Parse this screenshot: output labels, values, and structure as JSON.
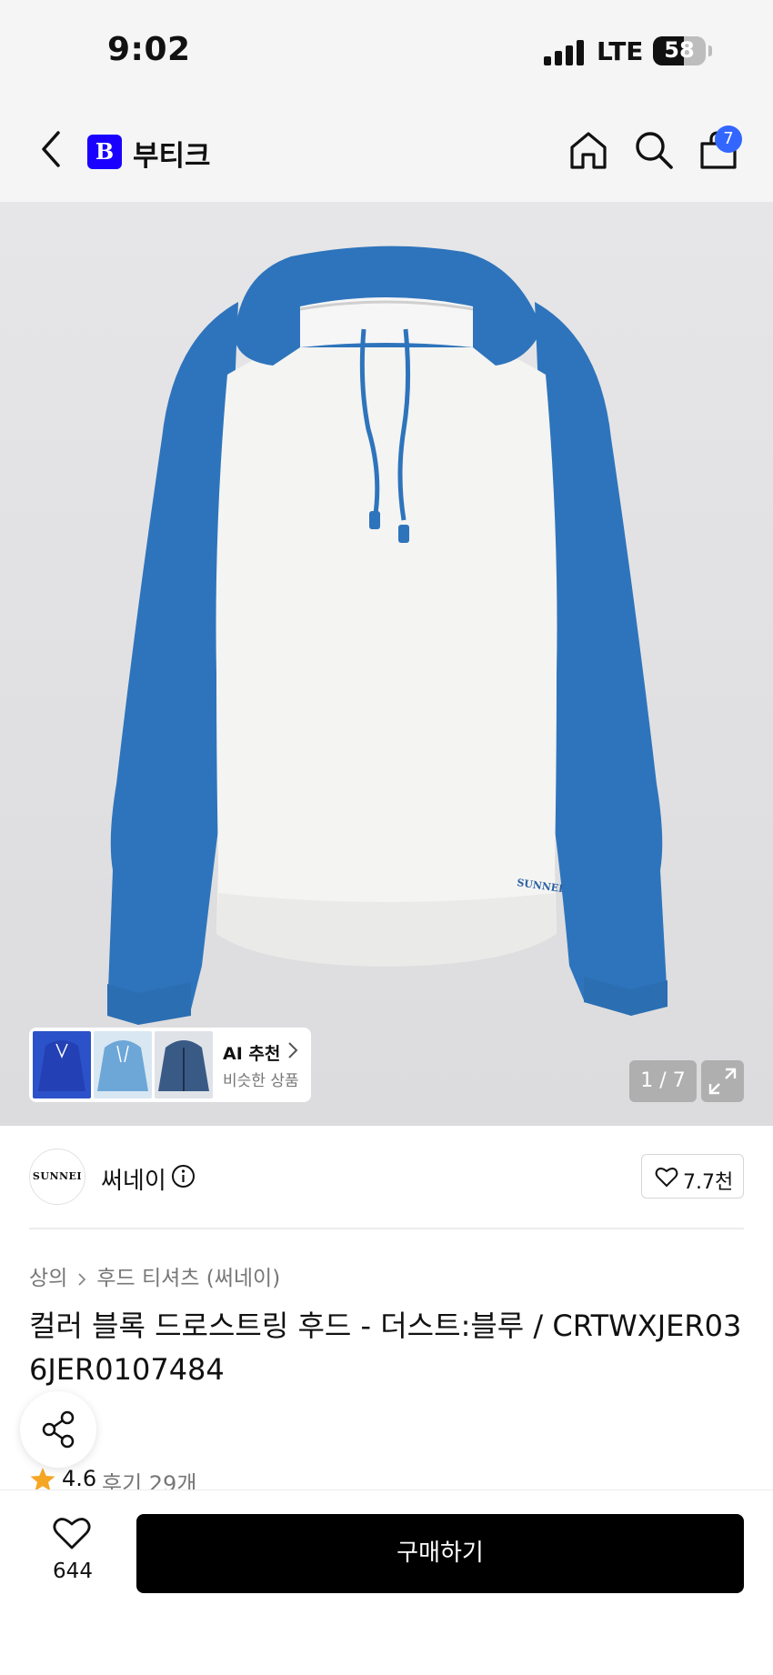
{
  "status_bar": {
    "time": "9:02",
    "network": "LTE",
    "battery": "58"
  },
  "nav": {
    "logo_letter": "B",
    "title": "부티크",
    "cart_count": "7"
  },
  "gallery": {
    "ai_title": "AI 추천",
    "ai_subtitle": "비슷한 상품",
    "page_indicator": "1 / 7",
    "current_index": 1,
    "total": 7
  },
  "brand": {
    "logo_text": "SUNNEI",
    "name": "써네이",
    "likes": "7.7천"
  },
  "product": {
    "breadcrumb": [
      "상의",
      "후드 티셔츠 (써네이)"
    ],
    "title": "컬러 블록 드로스트링 후드 - 더스트:블루 / CRTWXJER036JER0107484",
    "rating": "4.6",
    "reviews": "후기 29개"
  },
  "bottom": {
    "wish_count": "644",
    "buy_label": "구매하기"
  },
  "colors": {
    "accent_blue": "#3266ff",
    "brand_blue": "#1a00ff",
    "hoodie_blue": "#2e74bc",
    "star": "#f5a623"
  }
}
